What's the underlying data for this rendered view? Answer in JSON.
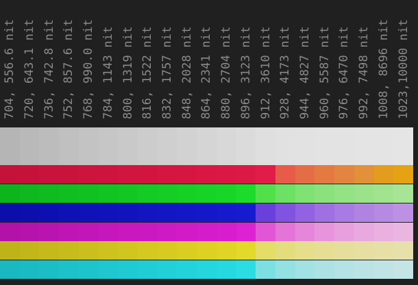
{
  "columns": [
    {
      "label": "704, 556.6 nit"
    },
    {
      "label": "720, 643.1 nit"
    },
    {
      "label": "736, 742.8 nit"
    },
    {
      "label": "752, 857.6 nit"
    },
    {
      "label": "768, 990.0 nit"
    },
    {
      "label": "784, 1143 nit"
    },
    {
      "label": "800, 1319 nit"
    },
    {
      "label": "816, 1522 nit"
    },
    {
      "label": "832, 1757 nit"
    },
    {
      "label": "848, 2028 nit"
    },
    {
      "label": "864, 2341 nit"
    },
    {
      "label": "880, 2704 nit"
    },
    {
      "label": "896, 3123 nit"
    },
    {
      "label": "912, 3610 nit"
    },
    {
      "label": "928, 4173 nit"
    },
    {
      "label": "944, 4827 nit"
    },
    {
      "label": "960, 5587 nit"
    },
    {
      "label": "976, 6470 nit"
    },
    {
      "label": "992, 7498 nit"
    },
    {
      "label": "1008, 8696 nit"
    },
    {
      "label": "1023,10000 nit"
    }
  ],
  "rows": {
    "white": [
      "#b5b5b5",
      "#b9b9b9",
      "#bcbcbc",
      "#c0c0c0",
      "#c3c3c3",
      "#c6c6c6",
      "#c9c9c9",
      "#cccccc",
      "#cfcfcf",
      "#d2d2d2",
      "#d5d5d5",
      "#d8d8d8",
      "#dbdbdb",
      "#dfdfdf",
      "#e1e1e1",
      "#e2e2e2",
      "#e3e3e3",
      "#e3e3e3",
      "#e4e4e4",
      "#e4e4e4",
      "#e5e5e5"
    ],
    "red": [
      "#c4123a",
      "#c6123b",
      "#c8133c",
      "#ca133c",
      "#cc143d",
      "#ce143e",
      "#d0153e",
      "#d2153f",
      "#d41640",
      "#d61641",
      "#d81742",
      "#da1843",
      "#dc1945",
      "#e21c48",
      "#e85a4a",
      "#e56d45",
      "#e47a42",
      "#e38540",
      "#e2903a",
      "#e39c1e",
      "#e4a214"
    ],
    "green": [
      "#0db51d",
      "#0eb81e",
      "#0fbb1f",
      "#10be20",
      "#11c121",
      "#12c422",
      "#13c723",
      "#14ca24",
      "#15cd25",
      "#16d026",
      "#17d327",
      "#18d628",
      "#1bdc2b",
      "#52e04a",
      "#6ce163",
      "#7fe273",
      "#8be27c",
      "#93e283",
      "#9be28a",
      "#a2e390",
      "#a8e496"
    ],
    "blue": [
      "#0b0ea8",
      "#0c0fac",
      "#0d10b0",
      "#0e11b3",
      "#0f12b7",
      "#1013ba",
      "#1114bd",
      "#1215c0",
      "#1316c3",
      "#1417c6",
      "#1518c9",
      "#1619cc",
      "#171bcf",
      "#6940dc",
      "#8053e0",
      "#9262e2",
      "#9f6fe3",
      "#a87ae3",
      "#b083e3",
      "#b68ae3",
      "#bc91e4"
    ],
    "magenta": [
      "#b212a8",
      "#b613ac",
      "#ba14b0",
      "#be15b4",
      "#c216b8",
      "#c517bb",
      "#c818be",
      "#cb19c1",
      "#ce1ac4",
      "#d11bc7",
      "#d41cca",
      "#d71dcd",
      "#dc22d2",
      "#e255d6",
      "#e574d9",
      "#e686db",
      "#e794dd",
      "#e89fde",
      "#e9a8df",
      "#e9b0e0",
      "#eab6e1"
    ],
    "yellow": [
      "#bfb31a",
      "#c2b61b",
      "#c5b91c",
      "#c8bc1d",
      "#cbbf1e",
      "#cec21f",
      "#d1c520",
      "#d4c821",
      "#d7cb22",
      "#dace23",
      "#ddd124",
      "#e0d425",
      "#e3d92a",
      "#e4dd68",
      "#e4dd7e",
      "#e5de8b",
      "#e5de94",
      "#e5df9b",
      "#e6dfa1",
      "#e6dfa6",
      "#e6e0ab"
    ],
    "cyan": [
      "#1ab8c0",
      "#1bbbc3",
      "#1cbec6",
      "#1dc1c9",
      "#1ec4cc",
      "#1fc7cf",
      "#20cad2",
      "#21cdd5",
      "#22d0d8",
      "#23d3db",
      "#24d6de",
      "#25d9e1",
      "#2bdde3",
      "#7ce0e3",
      "#93e1e3",
      "#a2e2e4",
      "#ace2e4",
      "#b4e2e5",
      "#bbe3e5",
      "#c0e3e5",
      "#c5e4e6"
    ]
  }
}
